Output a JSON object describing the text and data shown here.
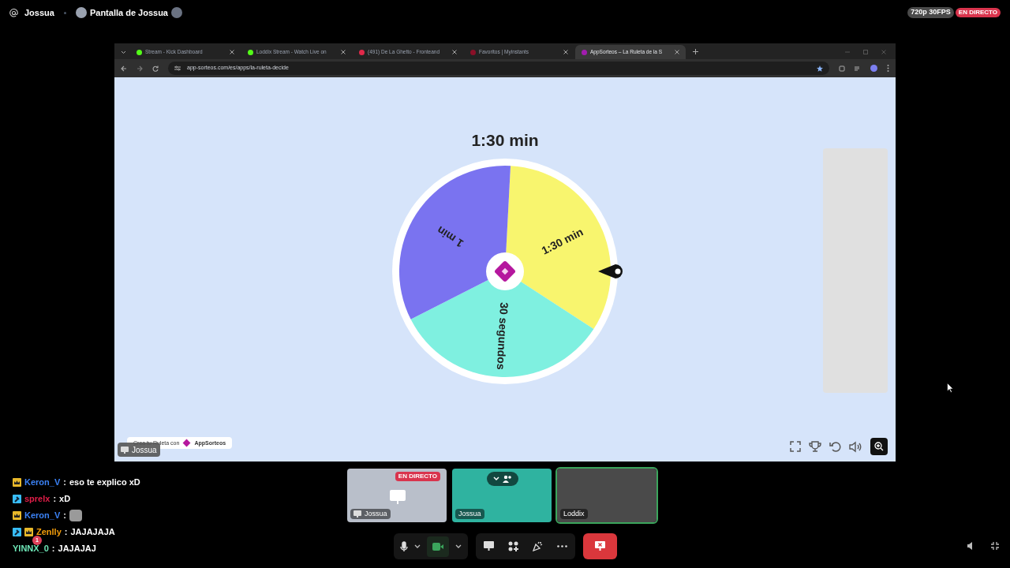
{
  "top_bar": {
    "channel": "Jossua",
    "stream_title": "Pantalla de Jossua",
    "quality": "720p 30FPS",
    "live_badge": "EN DIRECTO"
  },
  "browser": {
    "tabs": [
      {
        "title": "Stream - Kick Dashboard",
        "color": "#53fc18",
        "selected": false
      },
      {
        "title": "Loddix Stream - Watch Live on",
        "color": "#53fc18",
        "selected": false
      },
      {
        "title": "(491) De La Ghetto - Fronteand",
        "color": "#e0294a",
        "selected": false
      },
      {
        "title": "Favoritos | Myinstants",
        "color": "#8a1028",
        "selected": false
      },
      {
        "title": "AppSorteos – La Ruleta de la S",
        "color": "#a21caf",
        "selected": true
      }
    ],
    "url": "app-sorteos.com/es/apps/la-ruleta-decide",
    "page": {
      "result": "1:30 min",
      "segments": [
        {
          "label": "1:30 min",
          "color": "#f8f56e"
        },
        {
          "label": "30 segundos",
          "color": "#7ff0e0"
        },
        {
          "label": "1 min",
          "color": "#7a73f0"
        }
      ],
      "credit": "Crea tu Ruleta con",
      "brand": "AppSorteos"
    }
  },
  "share_label": "Jossua",
  "chat": [
    {
      "badges": [
        {
          "kind": "crown"
        }
      ],
      "user": "Keron_V",
      "color": "#3b82f6",
      "separator": ":",
      "message": "eso te explico xD",
      "emote": false
    },
    {
      "badges": [
        {
          "kind": "hammer"
        }
      ],
      "user": "sprelx",
      "color": "#e11d48",
      "separator": ":",
      "message": "xD",
      "emote": false
    },
    {
      "badges": [
        {
          "kind": "crown"
        }
      ],
      "user": "Keron_V",
      "color": "#3b82f6",
      "separator": ":",
      "emote": true
    },
    {
      "badges": [
        {
          "kind": "hammer"
        },
        {
          "kind": "crown"
        }
      ],
      "user": "Zenlly",
      "color": "#f59e0b",
      "separator": ":",
      "message": "JAJAJAJA",
      "emote": false
    },
    {
      "user": "YINNX_0",
      "color": "#6ee7b7",
      "separator": ":",
      "message": "JAJAJAJ",
      "emote": false,
      "notification": "1"
    }
  ],
  "tiles": [
    {
      "kind": "screen",
      "name": "Jossua",
      "live_badge": "EN DIRECTO",
      "speaking": false
    },
    {
      "kind": "camera",
      "name": "Jossua",
      "speaking": false
    },
    {
      "kind": "camera",
      "name": "Loddix",
      "speaking": true
    }
  ],
  "controls": {
    "camera_on": true
  }
}
